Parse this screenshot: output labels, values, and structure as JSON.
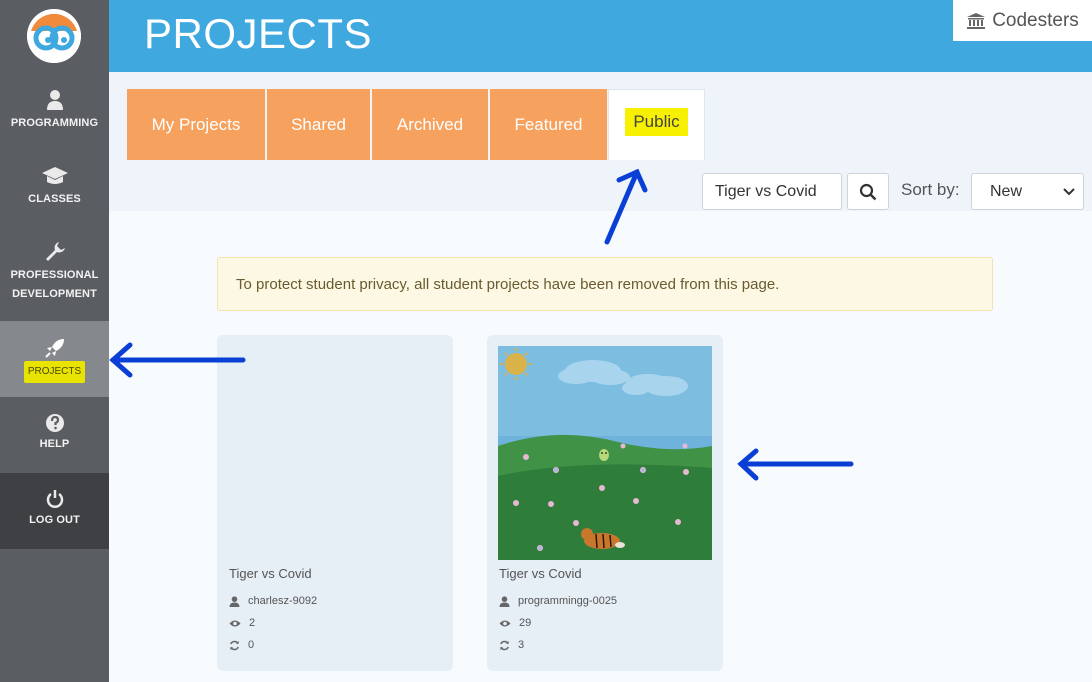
{
  "sidebar": {
    "items": [
      {
        "label": "PROGRAMMING",
        "icon": "user-icon"
      },
      {
        "label": "CLASSES",
        "icon": "graduation-cap-icon"
      },
      {
        "label": "PROFESSIONAL DEVELOPMENT",
        "icon": "wrench-icon"
      },
      {
        "label": "PROJECTS",
        "icon": "rocket-icon"
      },
      {
        "label": "HELP",
        "icon": "question-icon"
      },
      {
        "label": "LOG OUT",
        "icon": "power-icon"
      }
    ]
  },
  "header": {
    "title": "PROJECTS",
    "brand": "Codesters"
  },
  "tabs": [
    {
      "label": "My Projects"
    },
    {
      "label": "Shared"
    },
    {
      "label": "Archived"
    },
    {
      "label": "Featured"
    },
    {
      "label": "Public"
    }
  ],
  "search": {
    "value": "Tiger vs Covid"
  },
  "sort": {
    "label": "Sort by:",
    "selected": "New"
  },
  "notice": "To protect student privacy, all student projects have been removed from this page.",
  "projects": [
    {
      "title": "Tiger vs Covid",
      "author": "charlesz-9092",
      "views": "2",
      "remixes": "0"
    },
    {
      "title": "Tiger vs Covid",
      "author": "programmingg-0025",
      "views": "29",
      "remixes": "3"
    }
  ],
  "colors": {
    "header": "#3fa8de",
    "sidebar": "#5a5d62",
    "tab": "#f6a25e",
    "highlight": "#f7f000",
    "annotation_arrow": "#0a3fd6"
  }
}
